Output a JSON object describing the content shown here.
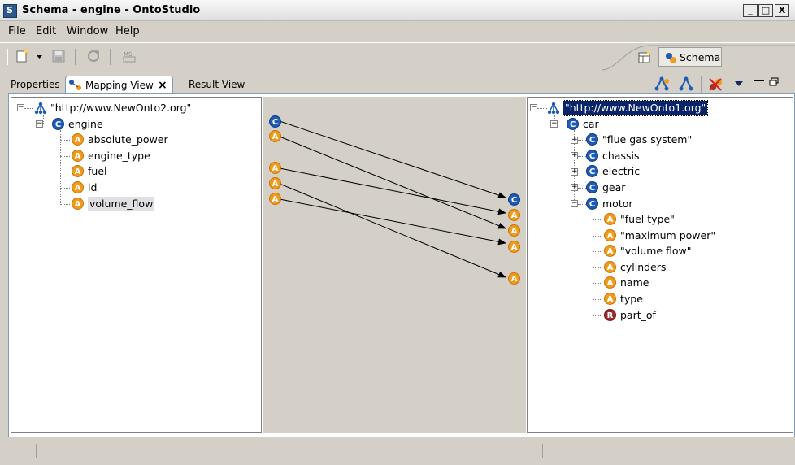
{
  "window": {
    "title": "Schema - engine - OntoStudio",
    "controls": {
      "minimize": "_",
      "maximize": "□",
      "close": "X"
    }
  },
  "menu": [
    "File",
    "Edit",
    "Window",
    "Help"
  ],
  "perspective": {
    "label": "Schema"
  },
  "tabs": [
    {
      "label": "Properties"
    },
    {
      "label": "Mapping View",
      "active": true,
      "close": "×"
    },
    {
      "label": "Result View"
    }
  ],
  "left_tree": {
    "root": "\"http://www.NewOnto2.org\"",
    "concept": {
      "badge": "C",
      "label": "engine"
    },
    "attributes": [
      {
        "badge": "A",
        "label": "absolute_power"
      },
      {
        "badge": "A",
        "label": "engine_type"
      },
      {
        "badge": "A",
        "label": "fuel"
      },
      {
        "badge": "A",
        "label": "id"
      },
      {
        "badge": "A",
        "label": "volume_flow"
      }
    ]
  },
  "right_tree": {
    "root": "\"http://www.NewOnto1.org\"",
    "concept": {
      "badge": "C",
      "label": "car"
    },
    "children": [
      {
        "badge": "C",
        "label": "\"flue gas system\"",
        "expander": "+"
      },
      {
        "badge": "C",
        "label": "chassis",
        "expander": "+"
      },
      {
        "badge": "C",
        "label": "electric",
        "expander": "+"
      },
      {
        "badge": "C",
        "label": "gear",
        "expander": "+"
      },
      {
        "badge": "C",
        "label": "motor",
        "expander": "−"
      }
    ],
    "motor_children": [
      {
        "badge": "A",
        "label": "\"fuel type\""
      },
      {
        "badge": "A",
        "label": "\"maximum power\""
      },
      {
        "badge": "A",
        "label": "\"volume flow\""
      },
      {
        "badge": "A",
        "label": "cylinders"
      },
      {
        "badge": "A",
        "label": "name"
      },
      {
        "badge": "A",
        "label": "type"
      },
      {
        "badge": "R",
        "label": "part_of"
      }
    ]
  },
  "mapping": {
    "source_badges": [
      "C",
      "A",
      "A",
      "A",
      "A"
    ],
    "target_badges": [
      "C",
      "A",
      "A",
      "A",
      "A"
    ]
  },
  "colors": {
    "concept": "#1d5bb5",
    "attribute": "#f29a1a",
    "relation": "#a02a2a",
    "selection": "#0a246a"
  }
}
